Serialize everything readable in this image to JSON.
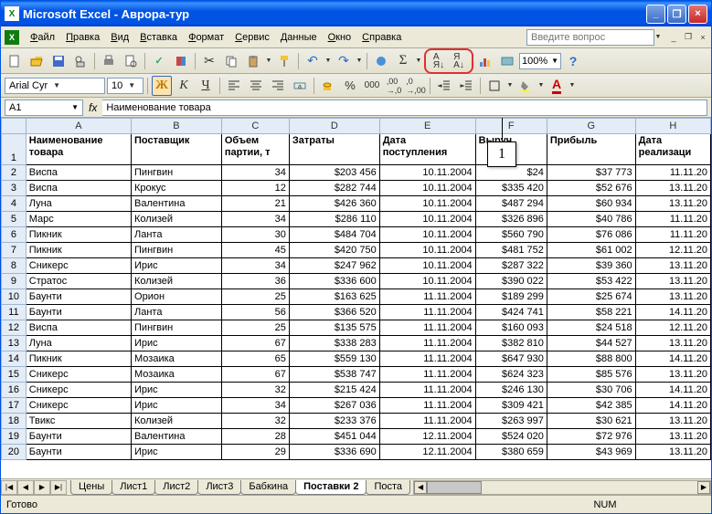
{
  "title": "Microsoft Excel - Аврора-тур",
  "menu": [
    "Файл",
    "Правка",
    "Вид",
    "Вставка",
    "Формат",
    "Сервис",
    "Данные",
    "Окно",
    "Справка"
  ],
  "askbox": "Введите вопрос",
  "font": {
    "name": "Arial Cyr",
    "size": "10"
  },
  "zoom": "100%",
  "namebox": "A1",
  "formula": "Наименование товара",
  "callout": "1",
  "cols": [
    "A",
    "B",
    "C",
    "D",
    "E",
    "F",
    "G",
    "H"
  ],
  "headers": [
    "Наименование товара",
    "Поставщик",
    "Объем партии, т",
    "Затраты",
    "Дата поступления",
    "Выруч",
    "Прибыль",
    "Дата реализаци"
  ],
  "rows": [
    {
      "r": 2,
      "c": [
        "Виспа",
        "Пингвин",
        "34",
        "$203 456",
        "10.11.2004",
        "$24",
        "$37 773",
        "11.11.20"
      ]
    },
    {
      "r": 3,
      "c": [
        "Виспа",
        "Крокус",
        "12",
        "$282 744",
        "10.11.2004",
        "$335 420",
        "$52 676",
        "13.11.20"
      ]
    },
    {
      "r": 4,
      "c": [
        "Луна",
        "Валентина",
        "21",
        "$426 360",
        "10.11.2004",
        "$487 294",
        "$60 934",
        "13.11.20"
      ]
    },
    {
      "r": 5,
      "c": [
        "Марс",
        "Колизей",
        "34",
        "$286 110",
        "10.11.2004",
        "$326 896",
        "$40 786",
        "11.11.20"
      ]
    },
    {
      "r": 6,
      "c": [
        "Пикник",
        "Ланта",
        "30",
        "$484 704",
        "10.11.2004",
        "$560 790",
        "$76 086",
        "11.11.20"
      ]
    },
    {
      "r": 7,
      "c": [
        "Пикник",
        "Пингвин",
        "45",
        "$420 750",
        "10.11.2004",
        "$481 752",
        "$61 002",
        "12.11.20"
      ]
    },
    {
      "r": 8,
      "c": [
        "Сникерс",
        "Ирис",
        "34",
        "$247 962",
        "10.11.2004",
        "$287 322",
        "$39 360",
        "13.11.20"
      ]
    },
    {
      "r": 9,
      "c": [
        "Стратос",
        "Колизей",
        "36",
        "$336 600",
        "10.11.2004",
        "$390 022",
        "$53 422",
        "13.11.20"
      ]
    },
    {
      "r": 10,
      "c": [
        "Баунти",
        "Орион",
        "25",
        "$163 625",
        "11.11.2004",
        "$189 299",
        "$25 674",
        "13.11.20"
      ]
    },
    {
      "r": 11,
      "c": [
        "Баунти",
        "Ланта",
        "56",
        "$366 520",
        "11.11.2004",
        "$424 741",
        "$58 221",
        "14.11.20"
      ]
    },
    {
      "r": 12,
      "c": [
        "Виспа",
        "Пингвин",
        "25",
        "$135 575",
        "11.11.2004",
        "$160 093",
        "$24 518",
        "12.11.20"
      ]
    },
    {
      "r": 13,
      "c": [
        "Луна",
        "Ирис",
        "67",
        "$338 283",
        "11.11.2004",
        "$382 810",
        "$44 527",
        "13.11.20"
      ]
    },
    {
      "r": 14,
      "c": [
        "Пикник",
        "Мозаика",
        "65",
        "$559 130",
        "11.11.2004",
        "$647 930",
        "$88 800",
        "14.11.20"
      ]
    },
    {
      "r": 15,
      "c": [
        "Сникерс",
        "Мозаика",
        "67",
        "$538 747",
        "11.11.2004",
        "$624 323",
        "$85 576",
        "13.11.20"
      ]
    },
    {
      "r": 16,
      "c": [
        "Сникерс",
        "Ирис",
        "32",
        "$215 424",
        "11.11.2004",
        "$246 130",
        "$30 706",
        "14.11.20"
      ]
    },
    {
      "r": 17,
      "c": [
        "Сникерс",
        "Ирис",
        "34",
        "$267 036",
        "11.11.2004",
        "$309 421",
        "$42 385",
        "14.11.20"
      ]
    },
    {
      "r": 18,
      "c": [
        "Твикс",
        "Колизей",
        "32",
        "$233 376",
        "11.11.2004",
        "$263 997",
        "$30 621",
        "13.11.20"
      ]
    },
    {
      "r": 19,
      "c": [
        "Баунти",
        "Валентина",
        "28",
        "$451 044",
        "12.11.2004",
        "$524 020",
        "$72 976",
        "13.11.20"
      ]
    },
    {
      "r": 20,
      "c": [
        "Баунти",
        "Ирис",
        "29",
        "$336 690",
        "12.11.2004",
        "$380 659",
        "$43 969",
        "13.11.20"
      ]
    }
  ],
  "tabs": [
    "Цены",
    "Лист1",
    "Лист2",
    "Лист3",
    "Бабкина",
    "Поставки 2",
    "Поста"
  ],
  "active_tab": 5,
  "status": {
    "ready": "Готово",
    "num": "NUM"
  }
}
